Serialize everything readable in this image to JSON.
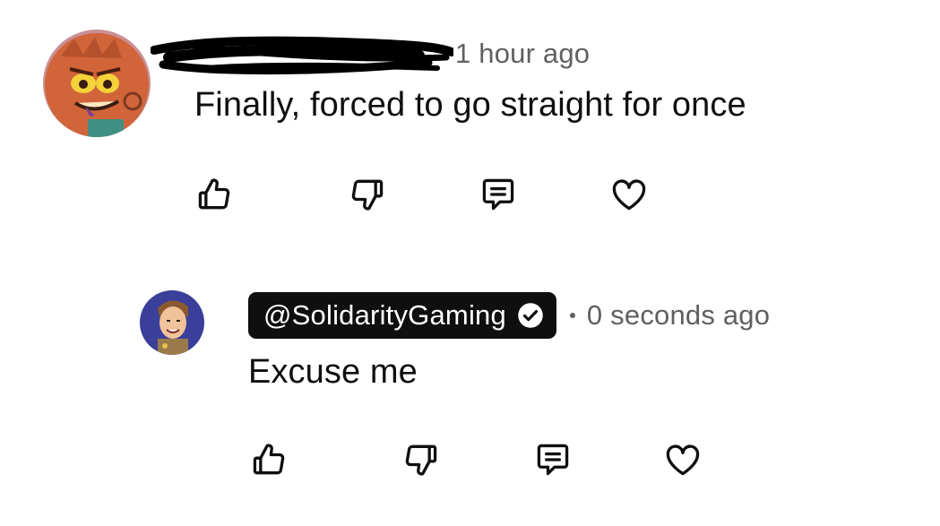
{
  "comments": [
    {
      "author_redacted": true,
      "time": "1 hour ago",
      "text": "Finally, forced to go straight for once",
      "actions": {
        "like_icon": "thumbs-up-icon",
        "dislike_icon": "thumbs-down-icon",
        "reply_icon": "comment-icon",
        "heart_icon": "heart-icon"
      }
    },
    {
      "author": "@SolidarityGaming",
      "verified": true,
      "time": "0 seconds ago",
      "text": "Excuse me",
      "actions": {
        "like_icon": "thumbs-up-icon",
        "dislike_icon": "thumbs-down-icon",
        "reply_icon": "comment-icon",
        "heart_icon": "heart-icon"
      }
    }
  ],
  "colors": {
    "text": "#0f0f0f",
    "secondary_text": "#606060",
    "pill_background": "#0f0f0f",
    "pill_text": "#ffffff",
    "avatar1_background": "#d2643a",
    "avatar2_background": "#3a3f9a"
  }
}
